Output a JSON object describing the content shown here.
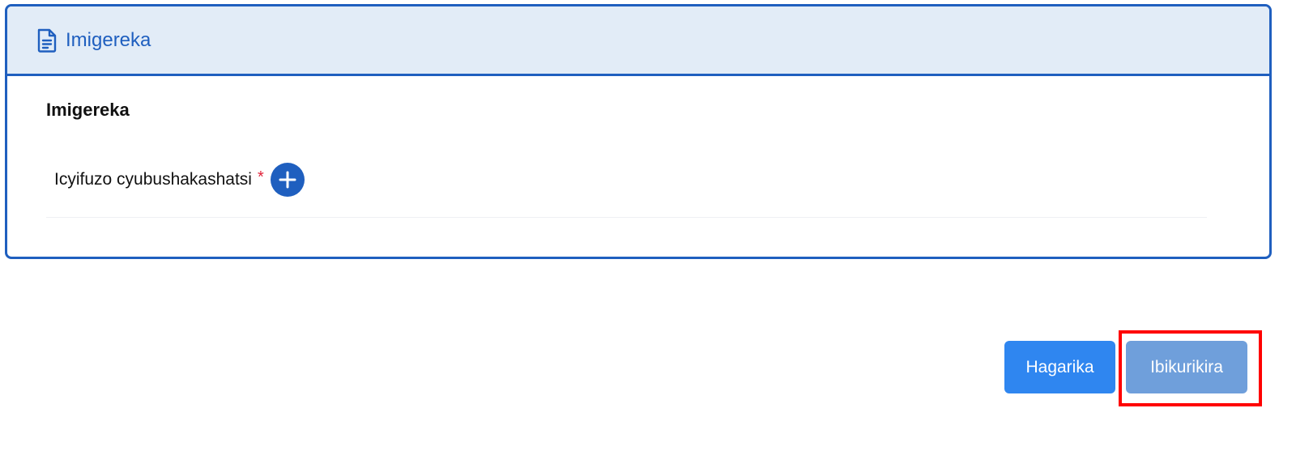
{
  "card": {
    "header_icon": "document-icon",
    "header_title": "Imigereka",
    "section_title": "Imigereka",
    "field": {
      "label": "Icyifuzo cyubushakashatsi",
      "required_mark": "*",
      "add_icon": "plus-icon"
    }
  },
  "actions": {
    "cancel_label": "Hagarika",
    "next_label": "Ibikurikira"
  },
  "colors": {
    "primary": "#1f5fbf",
    "header_bg": "#e2ecf7",
    "cancel_bg": "#2f86f0",
    "next_bg": "#6f9fdb",
    "required": "#e0243a",
    "highlight": "#ff0000"
  }
}
